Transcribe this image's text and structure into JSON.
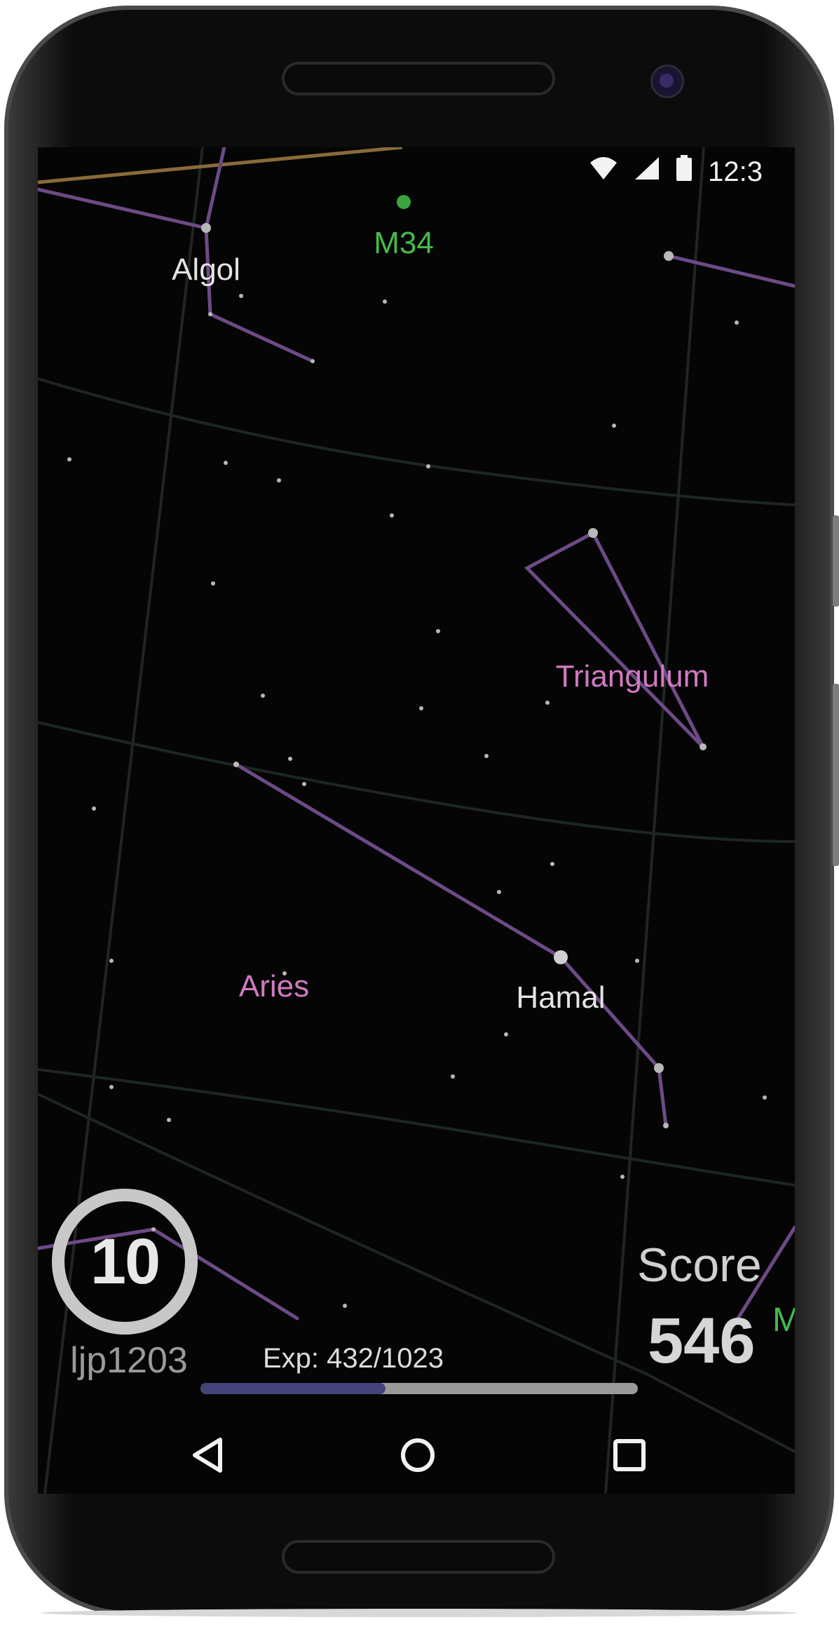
{
  "status_bar": {
    "time": "12:3",
    "wifi_icon": "wifi-icon",
    "signal_icon": "signal-icon",
    "battery_icon": "battery-icon"
  },
  "sky_labels": {
    "algol": "Algol",
    "m34": "M34",
    "triangulum": "Triangulum",
    "aries": "Aries",
    "hamal": "Hamal"
  },
  "player": {
    "level": "10",
    "username": "ljp1203"
  },
  "experience": {
    "text": "Exp: 432/1023",
    "current": 432,
    "max": 1023
  },
  "score": {
    "label": "Score",
    "value": "546"
  },
  "edge_label": "M",
  "navigation": {
    "back_icon": "back-triangle-icon",
    "home_icon": "home-circle-icon",
    "recents_icon": "recents-square-icon"
  },
  "colors": {
    "background": "#050505",
    "constellation_line": "#6d4b86",
    "constellation_label": "#d07ac2",
    "messier_label": "#47b84b",
    "grid_line": "#1e2624",
    "ecliptic": "#8a6a3a",
    "exp_fill": "#44447a"
  }
}
